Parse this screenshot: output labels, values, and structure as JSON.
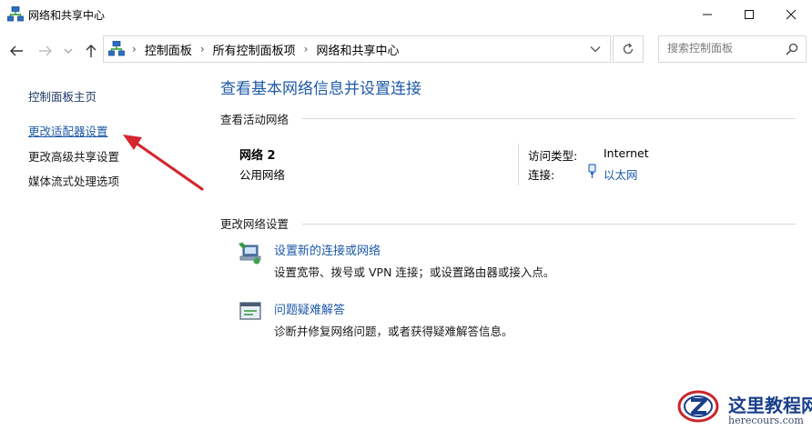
{
  "window": {
    "title": "网络和共享中心"
  },
  "address": {
    "crumbs": [
      "控制面板",
      "所有控制面板项",
      "网络和共享中心"
    ],
    "search_placeholder": "搜索控制面板"
  },
  "sidebar": {
    "items": [
      {
        "label": "控制面板主页"
      },
      {
        "label": "更改适配器设置"
      },
      {
        "label": "更改高级共享设置"
      },
      {
        "label": "媒体流式处理选项"
      }
    ]
  },
  "main": {
    "title": "查看基本网络信息并设置连接",
    "active_section": "查看活动网络",
    "network": {
      "name": "网络 2",
      "type": "公用网络",
      "access_label": "访问类型:",
      "access_value": "Internet",
      "connection_label": "连接:",
      "connection_value": "以太网"
    },
    "change_section": "更改网络设置",
    "actions": [
      {
        "link": "设置新的连接或网络",
        "desc": "设置宽带、拨号或 VPN 连接；或设置路由器或接入点。"
      },
      {
        "link": "问题疑难解答",
        "desc": "诊断并修复网络问题，或者获得疑难解答信息。"
      }
    ]
  },
  "watermark": {
    "text": "这里教程网",
    "url": "herecours.com"
  },
  "colors": {
    "link": "#1e5aa8",
    "arrow": "#d4262e",
    "rule": "#d8d8d8"
  }
}
